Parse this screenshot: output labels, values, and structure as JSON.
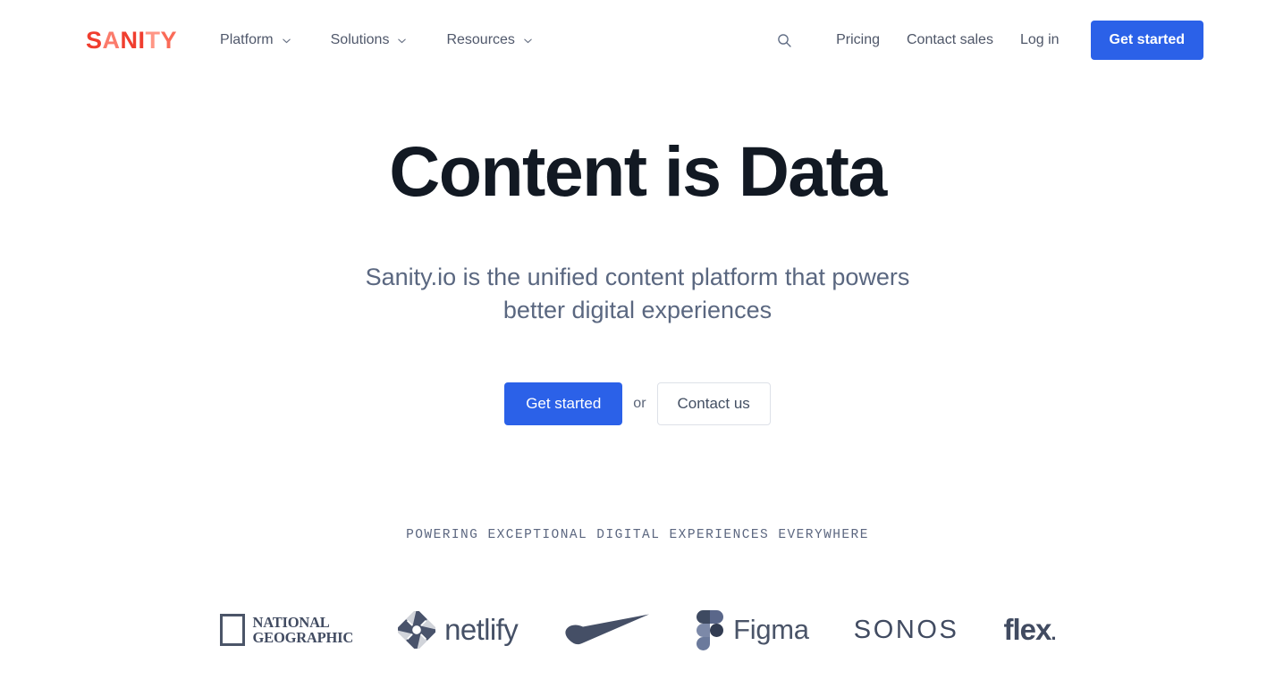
{
  "brand": {
    "logo_text": "SANITY",
    "logo_color": "#F03E2F",
    "accent_color": "#2B61E8"
  },
  "header": {
    "nav_items": [
      {
        "label": "Platform",
        "icon": "chevron-down-icon"
      },
      {
        "label": "Solutions",
        "icon": "chevron-down-icon"
      },
      {
        "label": "Resources",
        "icon": "chevron-down-icon"
      }
    ],
    "search_icon": "search-icon",
    "links": [
      {
        "label": "Pricing"
      },
      {
        "label": "Contact sales"
      },
      {
        "label": "Log in"
      }
    ],
    "cta": {
      "label": "Get started"
    }
  },
  "hero": {
    "title": "Content is Data",
    "subtitle": "Sanity.io is the unified content platform that powers better digital experiences",
    "primary_cta": "Get started",
    "separator": "or",
    "secondary_cta": "Contact us"
  },
  "social_proof": {
    "label": "POWERING EXCEPTIONAL DIGITAL EXPERIENCES EVERYWHERE",
    "logos": [
      {
        "name": "national-geographic",
        "line1": "NATIONAL",
        "line2": "GEOGRAPHIC"
      },
      {
        "name": "netlify",
        "wordmark": "netlify"
      },
      {
        "name": "nike",
        "wordmark": ""
      },
      {
        "name": "figma",
        "wordmark": "Figma"
      },
      {
        "name": "sonos",
        "wordmark": "SONOS"
      },
      {
        "name": "flex",
        "wordmark": "flex",
        "suffix": "."
      }
    ]
  }
}
